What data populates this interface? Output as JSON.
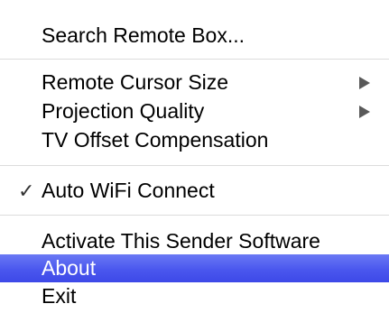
{
  "menu": {
    "items": [
      {
        "label": "Search Remote Box..."
      },
      {
        "label": "Remote Cursor Size",
        "submenu_icon": "submenu-arrow-icon"
      },
      {
        "label": "Projection Quality",
        "submenu_icon": "submenu-arrow-icon"
      },
      {
        "label": "TV Offset Compensation"
      },
      {
        "label": "Auto WiFi Connect",
        "checked": true,
        "check_glyph": "✓"
      },
      {
        "label": "Activate This Sender Software"
      },
      {
        "label": "About",
        "highlighted": true
      },
      {
        "label": "Exit"
      }
    ],
    "highlight_color": "#4a57ee"
  }
}
